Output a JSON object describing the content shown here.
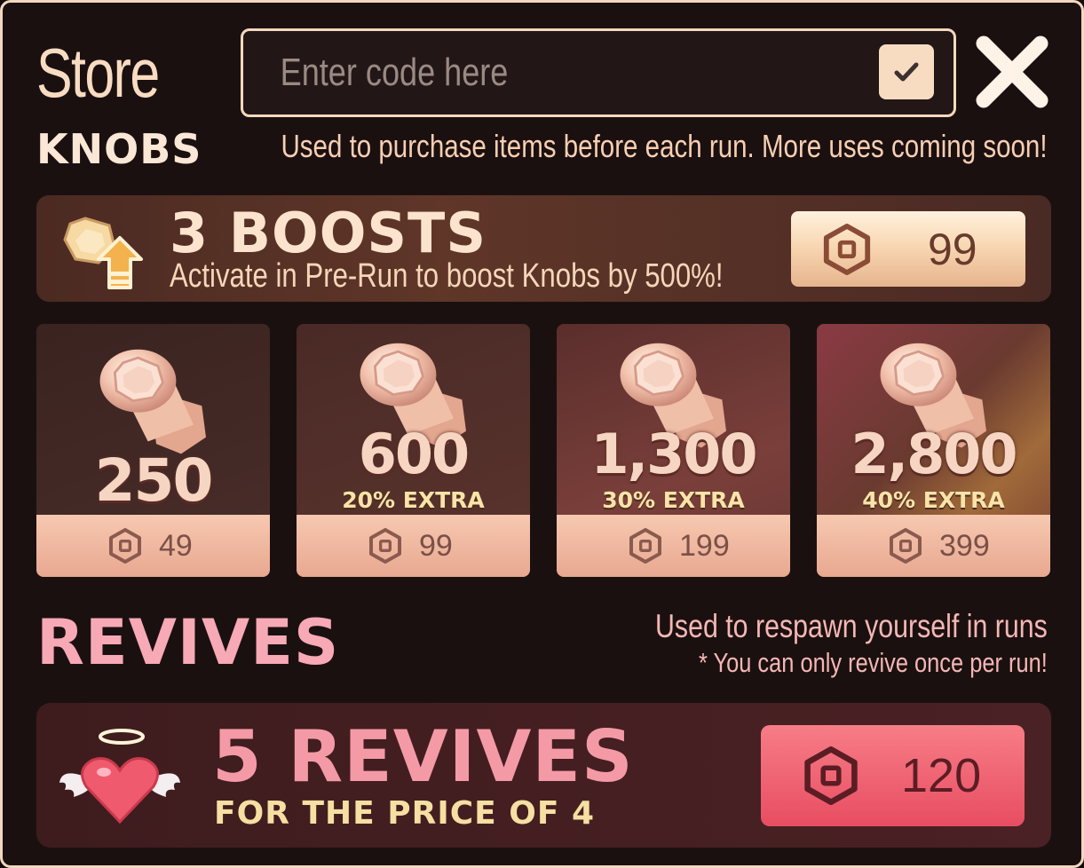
{
  "header": {
    "title": "Store",
    "code_placeholder": "Enter code here",
    "submit_icon": "checkmark-icon",
    "close_icon": "close-icon"
  },
  "knobs": {
    "title": "KNOBS",
    "description": "Used to purchase items before each run. More uses coming soon!",
    "boost": {
      "title": "3 BOOSTS",
      "subtitle": "Activate in Pre-Run to boost Knobs by 500%!",
      "price": "99",
      "icon": "knob-boost-icon"
    },
    "packs": [
      {
        "amount": "250",
        "extra": "",
        "price": "49"
      },
      {
        "amount": "600",
        "extra": "20% EXTRA",
        "price": "99"
      },
      {
        "amount": "1,300",
        "extra": "30% EXTRA",
        "price": "199"
      },
      {
        "amount": "2,800",
        "extra": "40% EXTRA",
        "price": "399"
      }
    ]
  },
  "revives": {
    "title": "REVIVES",
    "description_line1": "Used to respawn yourself in runs",
    "description_line2": "* You can only revive once per run!",
    "offer": {
      "title": "5 REVIVES",
      "subtitle": "FOR THE PRICE OF 4",
      "price": "120",
      "icon": "winged-heart-icon"
    }
  },
  "colors": {
    "panel_bg": "#1b1010",
    "border": "#f3d8bf",
    "knobs_accent": "#fbe7d6",
    "revives_accent": "#f7a9b6",
    "revive_button": "#e84d62"
  }
}
